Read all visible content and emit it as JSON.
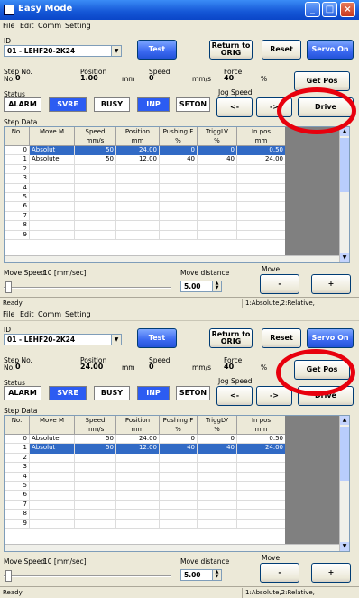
{
  "window": {
    "title": "Easy Mode"
  },
  "menu": [
    "File",
    "Edit",
    "Comm",
    "Setting"
  ],
  "labels": {
    "id": "ID",
    "step_no": "Step No.",
    "no": "No.",
    "position": "Position",
    "speed": "Speed",
    "force": "Force",
    "status": "Status",
    "jog_speed": "Jog Speed",
    "step_data": "Step Data",
    "move_speed": "Move Speed",
    "move_speed_value": "10 [mm/sec]",
    "move_distance": "Move distance",
    "move": "Move"
  },
  "units": {
    "mm": "mm",
    "mms": "mm/s",
    "pct": "%"
  },
  "buttons": {
    "test": "Test",
    "return_to_orig": "Return to ORIG",
    "reset": "Reset",
    "servo_on": "Servo On",
    "get_pos": "Get Pos",
    "drive": "Drive",
    "jog_left": "<-",
    "jog_right": "->",
    "move_minus": "-",
    "move_plus": "+"
  },
  "status_items": [
    {
      "label": "ALARM",
      "on": false
    },
    {
      "label": "SVRE",
      "on": true
    },
    {
      "label": "BUSY",
      "on": false
    },
    {
      "label": "INP",
      "on": true
    },
    {
      "label": "SETON",
      "on": false
    }
  ],
  "grid_headers": [
    {
      "top": "No.",
      "bottom": ""
    },
    {
      "top": "Move M",
      "bottom": ""
    },
    {
      "top": "Speed",
      "bottom": "mm/s"
    },
    {
      "top": "Position",
      "bottom": "mm"
    },
    {
      "top": "Pushing F",
      "bottom": "%"
    },
    {
      "top": "TriggLV",
      "bottom": "%"
    },
    {
      "top": "In pos",
      "bottom": "mm"
    }
  ],
  "panels": [
    {
      "id": "ID",
      "id_value": "01 - LEHF20-2K24",
      "step_no": "0",
      "position": "1.00",
      "speed": "0",
      "force": "40",
      "rows": [
        {
          "no": "0",
          "move": "Absolut",
          "speed": "50",
          "position": "24.00",
          "push": "0",
          "trig": "0",
          "inpos": "0.50"
        },
        {
          "no": "1",
          "move": "Absolute",
          "speed": "50",
          "position": "12.00",
          "push": "40",
          "trig": "40",
          "inpos": "24.00"
        },
        {
          "no": "2"
        },
        {
          "no": "3"
        },
        {
          "no": "4"
        },
        {
          "no": "5"
        },
        {
          "no": "6"
        },
        {
          "no": "7"
        },
        {
          "no": "8"
        },
        {
          "no": "9"
        }
      ],
      "selected_row": 0,
      "move_distance": "5.00",
      "status_left": "Ready",
      "status_right": "1:Absolute,2:Relative,"
    },
    {
      "id": "ID",
      "id_value": "01 - LEHF20-2K24",
      "step_no": "0",
      "position": "24.00",
      "speed": "0",
      "force": "40",
      "rows": [
        {
          "no": "0",
          "move": "Absolute",
          "speed": "50",
          "position": "24.00",
          "push": "0",
          "trig": "0",
          "inpos": "0.50"
        },
        {
          "no": "1",
          "move": "Absolut",
          "speed": "50",
          "position": "12.00",
          "push": "40",
          "trig": "40",
          "inpos": "24.00"
        },
        {
          "no": "2"
        },
        {
          "no": "3"
        },
        {
          "no": "4"
        },
        {
          "no": "5"
        },
        {
          "no": "6"
        },
        {
          "no": "7"
        },
        {
          "no": "8"
        },
        {
          "no": "9"
        }
      ],
      "selected_row": 1,
      "move_distance": "5.00",
      "status_left": "Ready",
      "status_right": "1:Absolute,2:Relative,"
    }
  ],
  "colors": {
    "highlight": "#e8000d",
    "title_blue": "#1456d6",
    "active_blue": "#2c5cf2"
  }
}
